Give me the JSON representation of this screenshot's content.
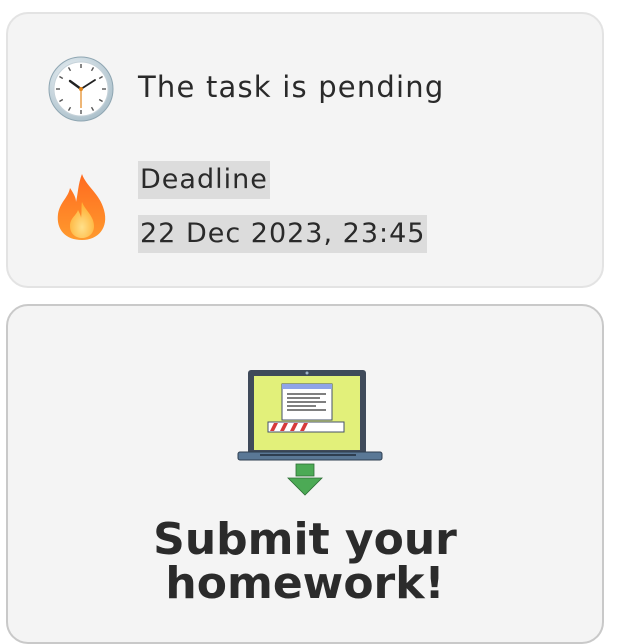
{
  "status": {
    "icon": "clock-icon",
    "text": "The task is pending"
  },
  "deadline": {
    "icon": "fire-icon",
    "label": "Deadline",
    "date": "22 Dec 2023, 23:45"
  },
  "submit": {
    "illustration": "laptop-upload-icon",
    "title": "Submit your homework!"
  }
}
